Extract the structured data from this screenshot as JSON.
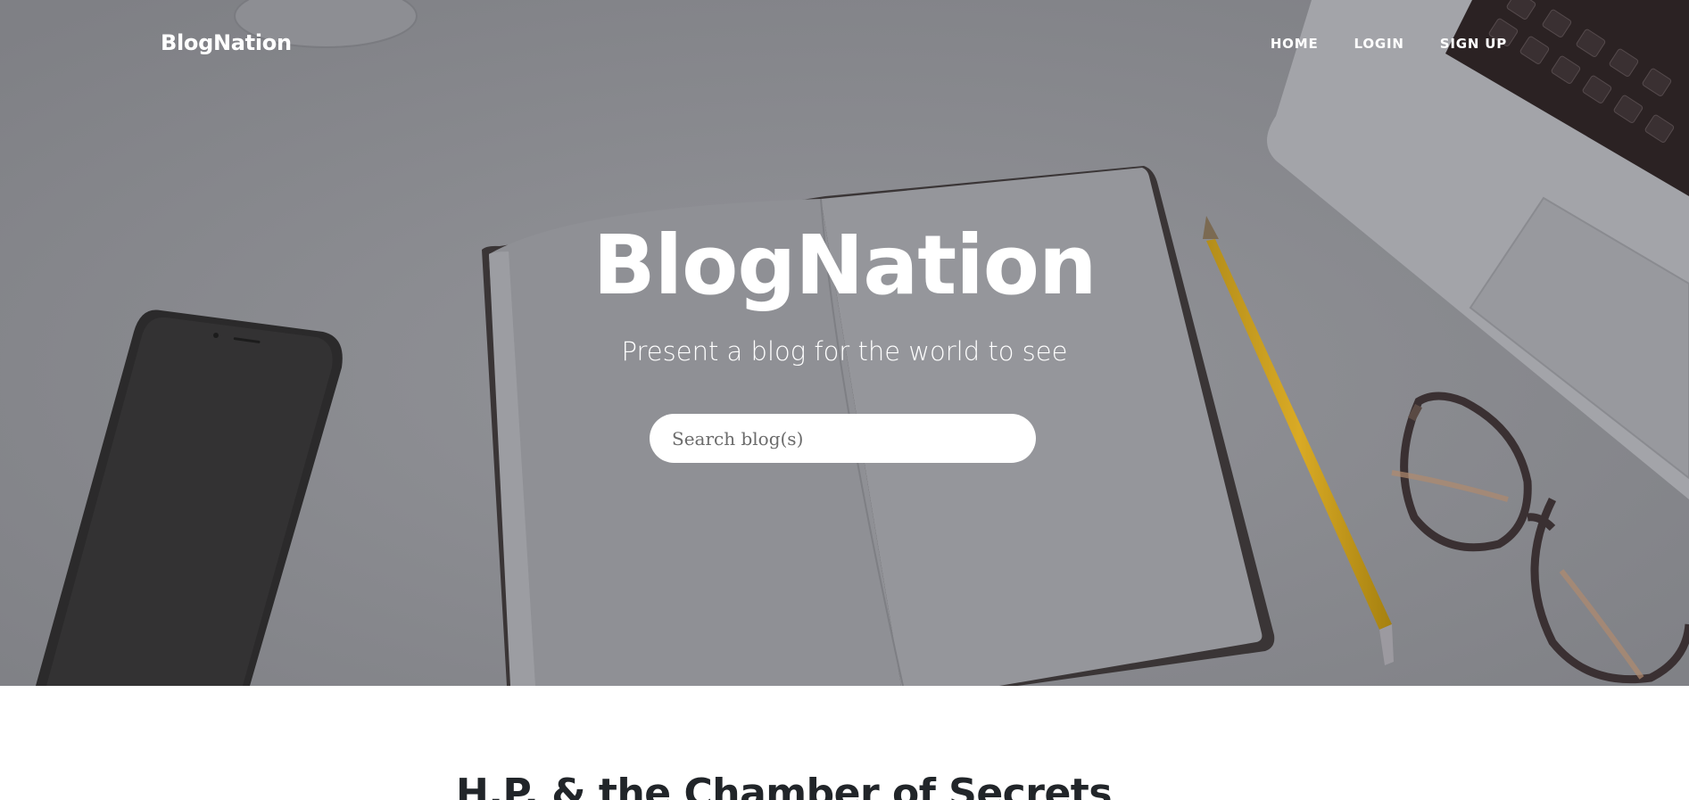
{
  "navbar": {
    "brand": "BlogNation",
    "links": [
      {
        "label": "HOME"
      },
      {
        "label": "LOGIN"
      },
      {
        "label": "SIGN UP"
      }
    ]
  },
  "hero": {
    "title": "BlogNation",
    "subtitle": "Present a blog for the world to see",
    "search": {
      "placeholder": "Search blog(s)",
      "value": ""
    }
  },
  "posts": [
    {
      "title": "H.P. & the Chamber of Secrets"
    }
  ],
  "colors": {
    "hero_tint": "#8a8b8f",
    "text_light": "#ffffff",
    "text_dark": "#212529"
  }
}
